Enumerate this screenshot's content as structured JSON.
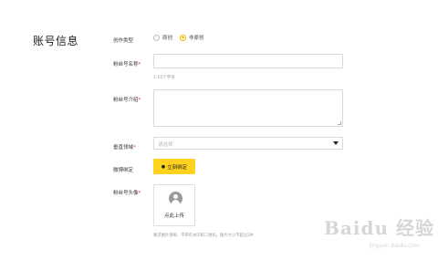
{
  "section": {
    "title": "账号信息"
  },
  "fields": {
    "creation_type": {
      "label": "创作类型",
      "options": [
        {
          "label": "原创",
          "checked": false
        },
        {
          "label": "非原创",
          "checked": true
        }
      ]
    },
    "account_name": {
      "label": "粉丝号名称",
      "required_mark": "*",
      "value": "",
      "hint": "1-15个字符"
    },
    "account_intro": {
      "label": "粉丝号介绍",
      "required_mark": "*",
      "value": ""
    },
    "domain": {
      "label": "垂直领域",
      "required_mark": "*",
      "placeholder": "请选择"
    },
    "weibo_bind": {
      "label": "微博绑定",
      "button_label": "立刻绑定",
      "button_icon": "weibo-icon"
    },
    "avatar": {
      "label": "粉丝号头像",
      "required_mark": "*",
      "upload_label": "点此上传",
      "hint": "要求图片清晰，不带有水印和二维码，图片大小不超过2M"
    }
  },
  "watermark": {
    "brand": "Baidu 经验",
    "url": "jingyan.baidu.com"
  },
  "colors": {
    "accent": "#ffd21f",
    "radio_checked": "#f2b600",
    "required": "#e0301e"
  }
}
